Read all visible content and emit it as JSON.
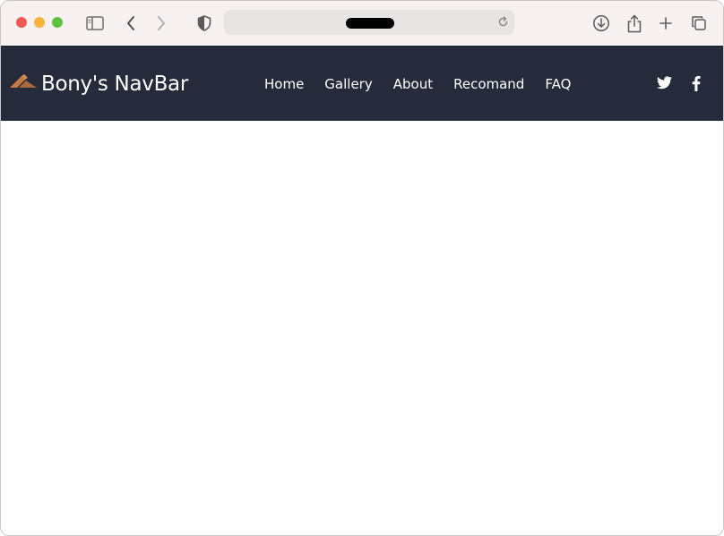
{
  "browser": {
    "traffic_lights": {
      "close_color": "#ee5b54",
      "minimize_color": "#f5b43a",
      "maximize_color": "#5ec242"
    },
    "address_bar": {
      "url": ""
    },
    "icons": {
      "sidebar": "sidebar-icon",
      "back": "chevron-left-icon",
      "forward": "chevron-right-icon",
      "privacy": "shield-icon",
      "reload": "reload-icon",
      "download": "download-icon",
      "share": "share-icon",
      "new_tab": "plus-icon",
      "tabs": "tabs-overview-icon"
    }
  },
  "site": {
    "navbar_color": "#252b3a",
    "brand": {
      "name": "Bony's NavBar",
      "logo_color": "#c27a45"
    },
    "nav_links": [
      {
        "label": "Home"
      },
      {
        "label": "Gallery"
      },
      {
        "label": "About"
      },
      {
        "label": "Recomand"
      },
      {
        "label": "FAQ"
      }
    ],
    "social": {
      "twitter": "twitter-icon",
      "facebook": "facebook-icon"
    }
  }
}
